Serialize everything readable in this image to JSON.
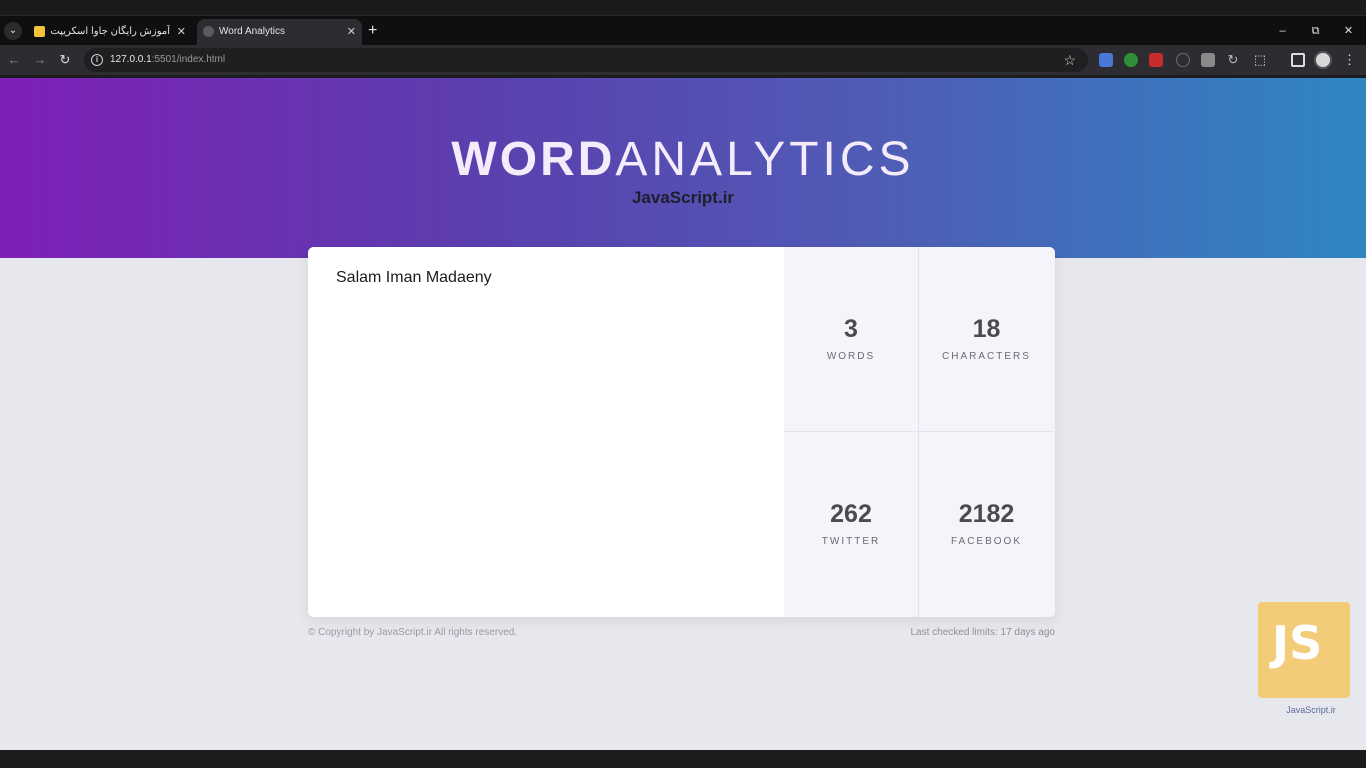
{
  "browser": {
    "tabs": [
      {
        "title": "آموزش رایگان جاوا اسکریپت از مقدماتی",
        "active": false
      },
      {
        "title": "Word Analytics",
        "active": true
      }
    ],
    "close_glyph": "✕",
    "new_tab_glyph": "+",
    "url_host": "127.0.0.1",
    "url_rest": ":5501/index.html",
    "window_controls": {
      "minimize": "–",
      "maximize": "⧉",
      "close": "✕"
    },
    "nav": {
      "back": "←",
      "forward": "→",
      "reload": "↻"
    },
    "star_glyph": "☆",
    "menu_glyph": "⋮",
    "tab_menu_glyph": "⌄",
    "ext_reload_glyph": "↻",
    "ext_puzzle_glyph": "⬚"
  },
  "page": {
    "brand_bold": "WORD",
    "brand_light": "ANALYTICS",
    "subtitle": "JavaScript.ir",
    "textarea_value": "Salam Iman Madaeny",
    "stats": [
      {
        "value": "3",
        "label": "WORDS"
      },
      {
        "value": "18",
        "label": "CHARACTERS"
      },
      {
        "value": "262",
        "label": "TWITTER"
      },
      {
        "value": "2182",
        "label": "FACEBOOK"
      }
    ],
    "footer_left": "© Copyright by JavaScript.ir All rights reserved.",
    "footer_right": "Last checked limits: 17 days ago",
    "watermark_text": "JavaScript.ir",
    "watermark_logo": "JS"
  },
  "colors": {
    "hero_start": "#7e1fb7",
    "hero_end": "#2f86c2",
    "stats_bg": "#f5f4fb",
    "page_bg": "#e7e8ed"
  }
}
